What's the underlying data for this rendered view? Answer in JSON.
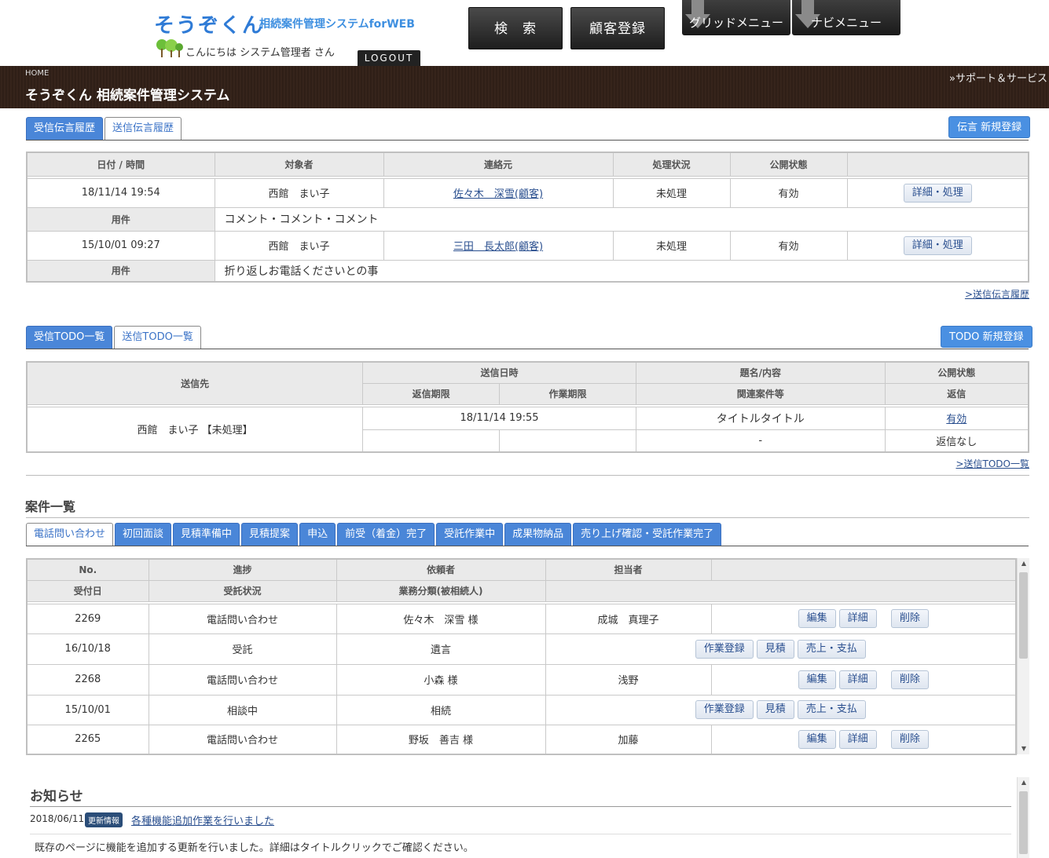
{
  "header": {
    "logo": "そうぞくん",
    "logo_sub": "相続案件管理システムforWEB",
    "greeting": "こんにちは システム管理者 さん",
    "logout": "LOGOUT",
    "search_btn": "検　索",
    "customer_btn": "顧客登録",
    "grid_menu": "グリッドメニュー",
    "navi_menu": "ナビメニュー",
    "breadcrumb": "HOME",
    "system_title": "そうぞくん 相続案件管理システム",
    "support_link": "»サポート＆サービス"
  },
  "messages": {
    "tabs": [
      "受信伝言履歴",
      "送信伝言履歴"
    ],
    "active_tab": 1,
    "new_btn": "伝言 新規登録",
    "columns": [
      "日付 / 時間",
      "対象者",
      "連絡元",
      "処理状況",
      "公開状態",
      ""
    ],
    "subject_label": "用件",
    "action_btn": "詳細・処理",
    "rows": [
      {
        "datetime": "18/11/14 19:54",
        "target": "西館　まい子",
        "contact": "佐々木　深雪(顧客)",
        "status": "未処理",
        "visibility": "有効",
        "subject": "コメント・コメント・コメント"
      },
      {
        "datetime": "15/10/01 09:27",
        "target": "西館　まい子",
        "contact": "三田　長太郎(顧客)",
        "status": "未処理",
        "visibility": "有効",
        "subject": "折り返しお電話くださいとの事"
      }
    ],
    "more_link": ">送信伝言履歴"
  },
  "todo": {
    "tabs": [
      "受信TODO一覧",
      "送信TODO一覧"
    ],
    "active_tab": 1,
    "new_btn": "TODO 新規登録",
    "headers": {
      "dest": "送信先",
      "sent": "送信日時",
      "reply_deadline": "返信期限",
      "work_deadline": "作業期限",
      "title": "題名/内容",
      "related": "関連案件等",
      "visibility": "公開状態",
      "reply": "返信"
    },
    "row": {
      "dest": "西館　まい子 【未処理】",
      "sent": "18/11/14 19:55",
      "title": "タイトルタイトル",
      "related": "-",
      "visibility": "有効",
      "reply": "返信なし"
    },
    "more_link": ">送信TODO一覧"
  },
  "cases": {
    "heading": "案件一覧",
    "tabs": [
      "電話問い合わせ",
      "初回面談",
      "見積準備中",
      "見積提案",
      "申込",
      "前受（着金）完了",
      "受託作業中",
      "成果物納品",
      "売り上げ確認・受託作業完了"
    ],
    "active_tab": 0,
    "headers": {
      "no": "No.",
      "progress": "進捗",
      "client": "依頼者",
      "staff": "担当者",
      "date": "受付日",
      "contract": "受託状況",
      "category": "業務分類(被相続人)"
    },
    "btns": {
      "edit": "編集",
      "detail": "詳細",
      "delete": "削除",
      "work": "作業登録",
      "estimate": "見積",
      "sales": "売上・支払"
    },
    "rows": [
      {
        "no": "2269",
        "progress": "電話問い合わせ",
        "client": "佐々木　深雪 様",
        "staff": "成城　真理子",
        "date": "16/10/18",
        "contract": "受託",
        "category": "遺言"
      },
      {
        "no": "2268",
        "progress": "電話問い合わせ",
        "client": "小森 様",
        "staff": "浅野",
        "date": "15/10/01",
        "contract": "相談中",
        "category": "相続"
      },
      {
        "no": "2265",
        "progress": "電話問い合わせ",
        "client": "野坂　善吉 様",
        "staff": "加藤"
      }
    ]
  },
  "notice": {
    "heading": "お知らせ",
    "date": "2018/06/11",
    "badge": "更新情報",
    "title": "各種機能追加作業を行いました",
    "body": "既存のページに機能を追加する更新を行いました。詳細はタイトルクリックでご確認ください。"
  }
}
